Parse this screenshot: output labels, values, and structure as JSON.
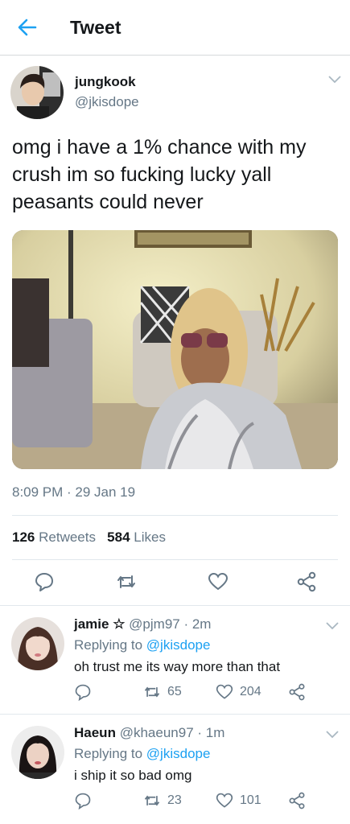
{
  "header": {
    "title": "Tweet",
    "back_icon": "arrow-left-icon",
    "accent": "#1da1f2"
  },
  "tweet": {
    "name": "jungkook",
    "handle": "@jkisdope",
    "text": "omg i have a 1% chance with my crush im so fucking lucky yall peasants could never",
    "time": "8:09 PM · 29 Jan 19",
    "retweets_count": "126",
    "retweets_label": "Retweets",
    "likes_count": "584",
    "likes_label": "Likes"
  },
  "replies": [
    {
      "name": "jamie ☆",
      "handle": "@pjm97",
      "age": "2m",
      "replying_label": "Replying to",
      "replying_to": "@jkisdope",
      "text": "oh trust me its way more than that",
      "retweets": "65",
      "likes": "204"
    },
    {
      "name": "Haeun",
      "handle": "@khaeun97",
      "age": "1m",
      "replying_label": "Replying to",
      "replying_to": "@jkisdope",
      "text": "i ship it so bad omg",
      "retweets": "23",
      "likes": "101"
    }
  ],
  "colors": {
    "text": "#14171a",
    "secondary": "#657786",
    "link": "#1da1f2",
    "divider": "#e1e8ed"
  }
}
